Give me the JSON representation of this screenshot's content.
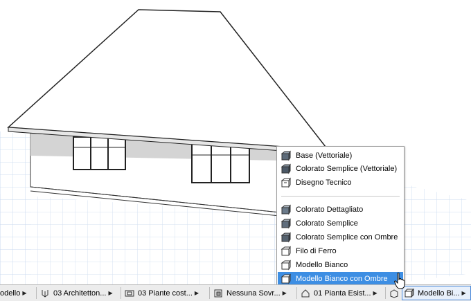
{
  "menu": {
    "items": [
      {
        "label": "Base (Vettoriale)",
        "icon": "base-vector-icon"
      },
      {
        "label": "Colorato Semplice (Vettoriale)",
        "icon": "shaded-vector-icon"
      },
      {
        "label": "Disegno Tecnico",
        "icon": "technical-drawing-icon"
      },
      {
        "label": "Colorato Dettagliato",
        "icon": "detailed-color-icon"
      },
      {
        "label": "Colorato Semplice",
        "icon": "simple-color-icon"
      },
      {
        "label": "Colorato Semplice con Ombre",
        "icon": "simple-shadow-icon"
      },
      {
        "label": "Filo di Ferro",
        "icon": "wireframe-icon"
      },
      {
        "label": "Modello Bianco",
        "icon": "white-model-icon"
      },
      {
        "label": "Modello Bianco con Ombre",
        "icon": "white-model-shadow-icon",
        "selected": true
      }
    ],
    "selected_color": "#3d8ee3"
  },
  "statusbar": {
    "items": [
      {
        "label": "odello",
        "icon": ""
      },
      {
        "label": "03 Architetton...",
        "icon": "pen-icon"
      },
      {
        "label": "03 Piante cost...",
        "icon": "plan-icon"
      },
      {
        "label": "Nessuna Sovr...",
        "icon": "override-icon"
      },
      {
        "label": "01 Pianta Esist...",
        "icon": "renovation-icon"
      },
      {
        "label": "Modello Bi...",
        "icon": "3d-style-icon"
      }
    ]
  }
}
